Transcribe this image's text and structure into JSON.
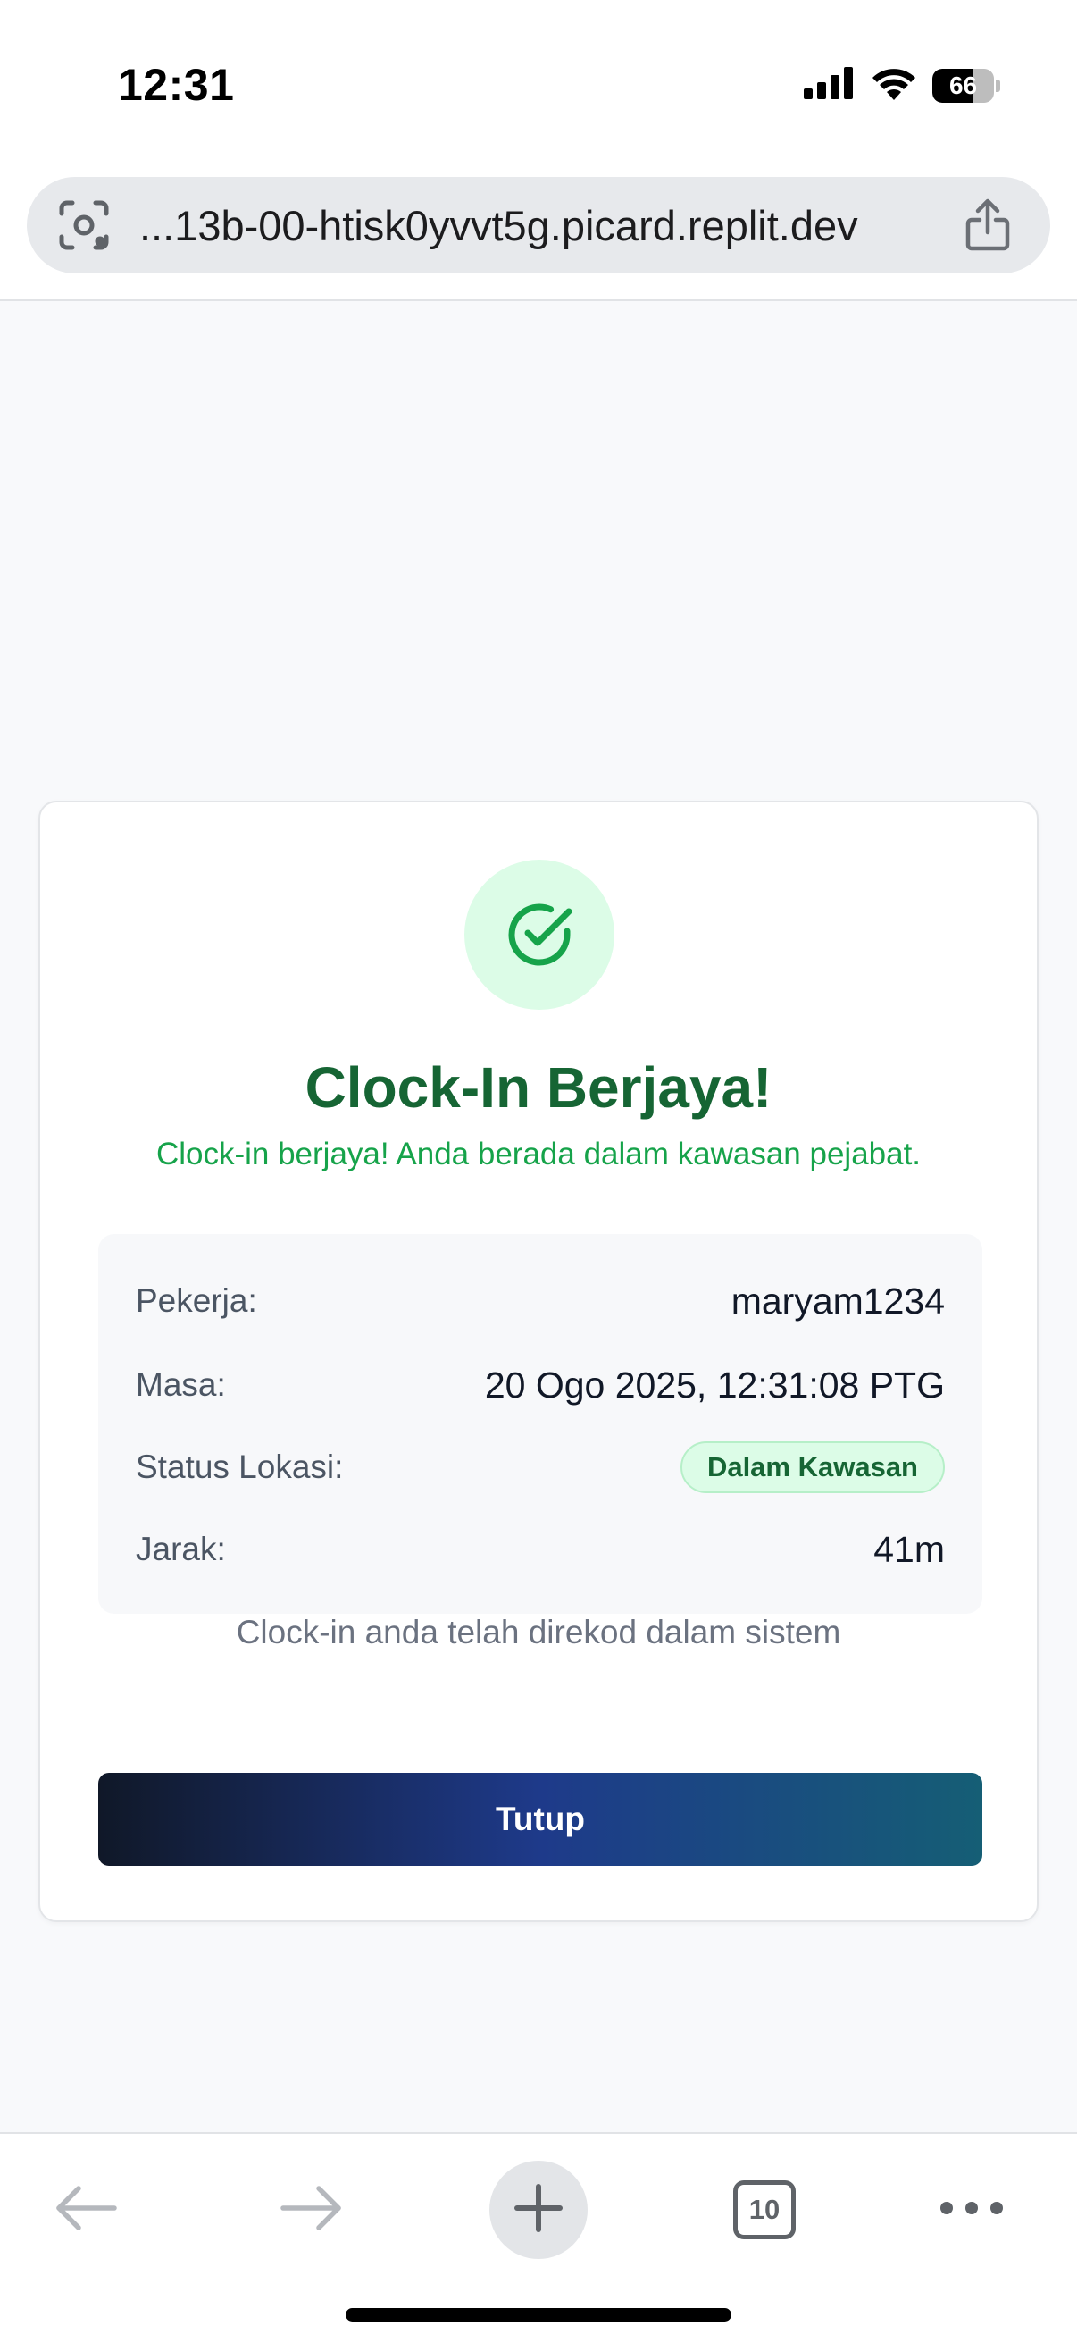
{
  "status_bar": {
    "time": "12:31",
    "battery_level": "66",
    "battery_fraction": 0.66,
    "icons": [
      "cellular-signal-icon",
      "wifi-icon",
      "battery-icon"
    ]
  },
  "browser": {
    "url": "...13b-00-htisk0yvvt5g.picard.replit.dev",
    "left_icon": "lens-icon",
    "right_icon": "share-icon"
  },
  "card": {
    "icon": "check-circle-icon",
    "title": "Clock-In Berjaya!",
    "subtitle": "Clock-in berjaya! Anda berada dalam kawasan pejabat.",
    "details": {
      "worker_label": "Pekerja:",
      "worker_value": "maryam1234",
      "time_label": "Masa:",
      "time_value": "20 Ogo 2025, 12:31:08 PTG",
      "location_label": "Status Lokasi:",
      "location_value": "Dalam Kawasan",
      "distance_label": "Jarak:",
      "distance_value": "41m"
    },
    "recorded_note": "Clock-in anda telah direkod dalam sistem",
    "close_label": "Tutup"
  },
  "toolbar": {
    "tab_count": "10",
    "icons": [
      "back-arrow-icon",
      "forward-arrow-icon",
      "plus-icon",
      "tabs-icon",
      "more-icon"
    ]
  },
  "colors": {
    "success_dark": "#166534",
    "success": "#16a34a",
    "success_bg": "#dcfce7",
    "button_gradient_start": "#101828",
    "button_gradient_mid": "#1e3a8a",
    "button_gradient_end": "#155e75"
  }
}
